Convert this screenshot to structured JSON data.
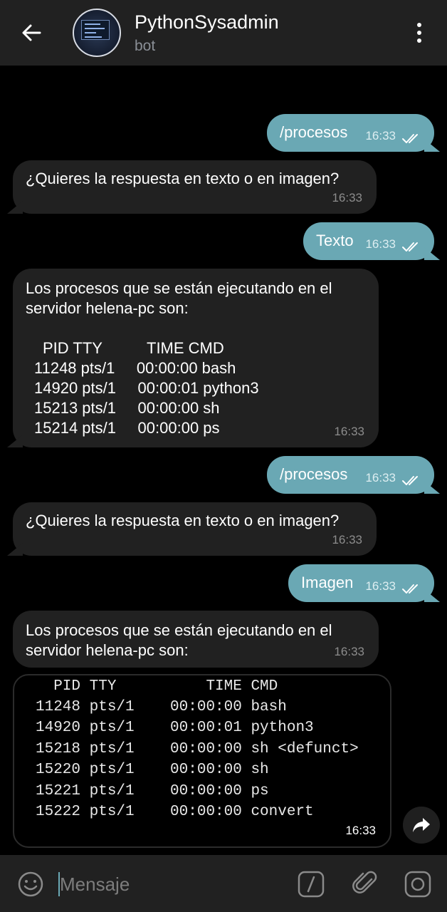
{
  "header": {
    "title": "PythonSysadmin",
    "subtitle": "bot"
  },
  "messages": {
    "m1": {
      "text": "/procesos",
      "time": "16:33"
    },
    "m2": {
      "text": "¿Quieres la respuesta en texto o en imagen?",
      "time": "16:33"
    },
    "m3": {
      "text": "Texto",
      "time": "16:33"
    },
    "m4": {
      "line1": "Los procesos que se están ejecutando en el",
      "line2": "servidor helena-pc son:",
      "header_row": "  PID TTY         TIME CMD",
      "rows": [
        "11248 pts/1     00:00:00 bash",
        "14920 pts/1     00:00:01 python3",
        "15213 pts/1     00:00:00 sh",
        "15214 pts/1     00:00:00 ps"
      ],
      "time": "16:33"
    },
    "m5": {
      "text": "/procesos",
      "time": "16:33"
    },
    "m6": {
      "text": "¿Quieres la respuesta en texto o en imagen?",
      "time": "16:33"
    },
    "m7": {
      "text": "Imagen",
      "time": "16:33"
    },
    "m8": {
      "line1": "Los procesos que se están ejecutando en el",
      "line2": "servidor helena-pc son:",
      "time": "16:33"
    },
    "m9": {
      "rows": [
        "  PID TTY          TIME CMD",
        "11248 pts/1    00:00:00 bash",
        "14920 pts/1    00:00:01 python3",
        "15218 pts/1    00:00:00 sh <defunct>",
        "15220 pts/1    00:00:00 sh",
        "15221 pts/1    00:00:00 ps",
        "15222 pts/1    00:00:00 convert"
      ],
      "time": "16:33"
    }
  },
  "input": {
    "placeholder": "Mensaje"
  },
  "colors": {
    "outgoing_bubble": "#6aa8b4",
    "incoming_bubble": "#212121",
    "header_bg": "#212121",
    "chat_bg": "#000000"
  },
  "icons": [
    "back-arrow-icon",
    "more-vert-icon",
    "double-check-icon",
    "share-forward-icon",
    "emoji-icon",
    "bot-command-icon",
    "attach-icon",
    "camera-icon"
  ]
}
